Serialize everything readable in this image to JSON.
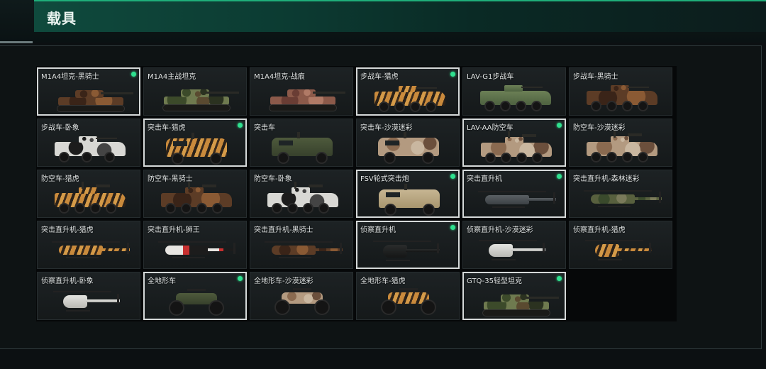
{
  "header": {
    "title": "载具"
  },
  "vehicles": [
    {
      "label": "M1A4坦克-黑骑士",
      "owned": true,
      "selected": true,
      "kind": "tank",
      "camo": "knight"
    },
    {
      "label": "M1A4主战坦克",
      "owned": false,
      "selected": false,
      "kind": "tank",
      "camo": "woodland"
    },
    {
      "label": "M1A4坦克-战痕",
      "owned": false,
      "selected": false,
      "kind": "tank",
      "camo": "pink"
    },
    {
      "label": "步战车-猎虎",
      "owned": true,
      "selected": true,
      "kind": "ifv",
      "camo": "tiger"
    },
    {
      "label": "LAV-G1步战车",
      "owned": false,
      "selected": false,
      "kind": "ifv",
      "camo": "green"
    },
    {
      "label": "步战车-黑骑士",
      "owned": false,
      "selected": false,
      "kind": "ifv",
      "camo": "knight"
    },
    {
      "label": "步战车-卧象",
      "owned": false,
      "selected": false,
      "kind": "ifv6",
      "camo": "spot"
    },
    {
      "label": "突击车-猎虎",
      "owned": true,
      "selected": true,
      "kind": "truck",
      "camo": "tiger"
    },
    {
      "label": "突击车",
      "owned": false,
      "selected": false,
      "kind": "truck",
      "camo": "olive"
    },
    {
      "label": "突击车-沙漠迷彩",
      "owned": false,
      "selected": false,
      "kind": "truck",
      "camo": "desert"
    },
    {
      "label": "LAV-AA防空车",
      "owned": true,
      "selected": true,
      "kind": "aa",
      "camo": "desert"
    },
    {
      "label": "防空车-沙漠迷彩",
      "owned": false,
      "selected": false,
      "kind": "aa",
      "camo": "desert"
    },
    {
      "label": "防空车-猎虎",
      "owned": false,
      "selected": false,
      "kind": "aa",
      "camo": "tiger"
    },
    {
      "label": "防空车-黑骑士",
      "owned": false,
      "selected": false,
      "kind": "aa",
      "camo": "knight"
    },
    {
      "label": "防空车-卧象",
      "owned": false,
      "selected": false,
      "kind": "aa",
      "camo": "spot"
    },
    {
      "label": "FSV轮式突击炮",
      "owned": true,
      "selected": true,
      "kind": "truck",
      "camo": "sand"
    },
    {
      "label": "突击直升机",
      "owned": true,
      "selected": true,
      "kind": "heli",
      "camo": "gray"
    },
    {
      "label": "突击直升机-森林迷彩",
      "owned": false,
      "selected": false,
      "kind": "heli",
      "camo": "forest"
    },
    {
      "label": "突击直升机-猎虎",
      "owned": false,
      "selected": false,
      "kind": "heli",
      "camo": "tiger"
    },
    {
      "label": "突击直升机-狮王",
      "owned": false,
      "selected": false,
      "kind": "heli",
      "camo": "lion"
    },
    {
      "label": "突击直升机-黑骑士",
      "owned": false,
      "selected": false,
      "kind": "heli",
      "camo": "knight"
    },
    {
      "label": "侦察直升机",
      "owned": true,
      "selected": true,
      "kind": "scout",
      "camo": "black"
    },
    {
      "label": "侦察直升机-沙漠迷彩",
      "owned": false,
      "selected": false,
      "kind": "scout",
      "camo": "white"
    },
    {
      "label": "侦察直升机-猎虎",
      "owned": false,
      "selected": false,
      "kind": "scout",
      "camo": "tiger"
    },
    {
      "label": "侦察直升机-卧象",
      "owned": false,
      "selected": false,
      "kind": "scout",
      "camo": "white"
    },
    {
      "label": "全地形车",
      "owned": true,
      "selected": true,
      "kind": "atv",
      "camo": "olive"
    },
    {
      "label": "全地形车-沙漠迷彩",
      "owned": false,
      "selected": false,
      "kind": "atv",
      "camo": "desert"
    },
    {
      "label": "全地形车-猎虎",
      "owned": false,
      "selected": false,
      "kind": "atv",
      "camo": "tiger"
    },
    {
      "label": "GTQ-35轻型坦克",
      "owned": true,
      "selected": true,
      "kind": "tank",
      "camo": "woodland"
    }
  ],
  "colors": {
    "accent": "#1fae7a",
    "owned_dot": "#2fe08f",
    "selected_border": "#d5d9d9"
  }
}
